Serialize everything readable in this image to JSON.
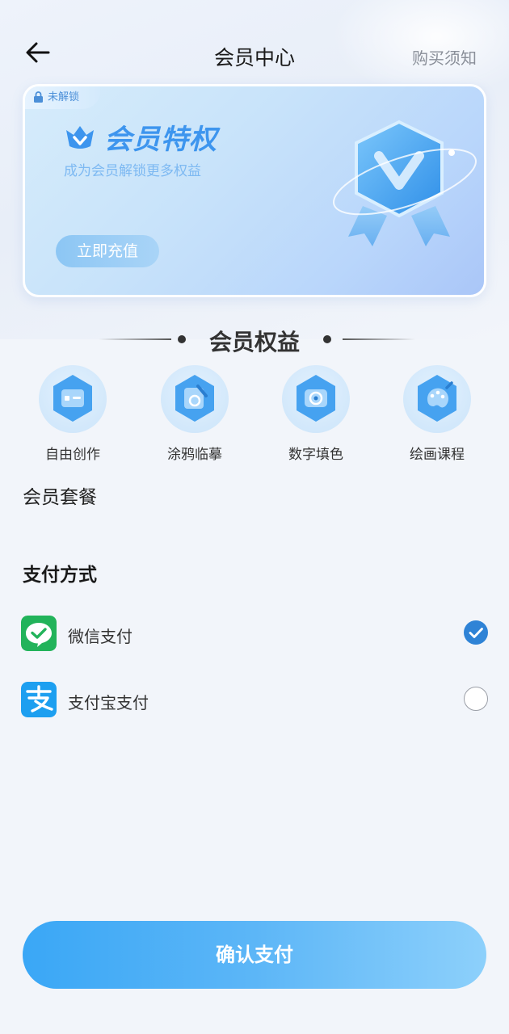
{
  "header": {
    "title": "会员中心",
    "notice_link": "购买须知"
  },
  "banner": {
    "lock_tag": "未解锁",
    "title": "会员特权",
    "subtitle": "成为会员解锁更多权益",
    "button_label": "立即充值"
  },
  "benefits": {
    "section_title": "会员权益",
    "items": [
      {
        "label": "自由创作",
        "icon": "card-icon"
      },
      {
        "label": "涂鸦临摹",
        "icon": "sketch-icon"
      },
      {
        "label": "数字填色",
        "icon": "camera-icon"
      },
      {
        "label": "绘画课程",
        "icon": "palette-icon"
      }
    ]
  },
  "plans": {
    "label": "会员套餐"
  },
  "payment": {
    "label": "支付方式",
    "methods": [
      {
        "name": "微信支付",
        "icon": "wechat-pay-icon",
        "selected": true,
        "color": "#22b35a"
      },
      {
        "name": "支付宝支付",
        "icon": "alipay-icon",
        "selected": false,
        "color": "#1d9ff0"
      }
    ]
  },
  "confirm_button": "确认支付",
  "colors": {
    "accent": "#2f83d6",
    "button_gradient_start": "#3aa7f6",
    "button_gradient_end": "#8dd0fb"
  }
}
